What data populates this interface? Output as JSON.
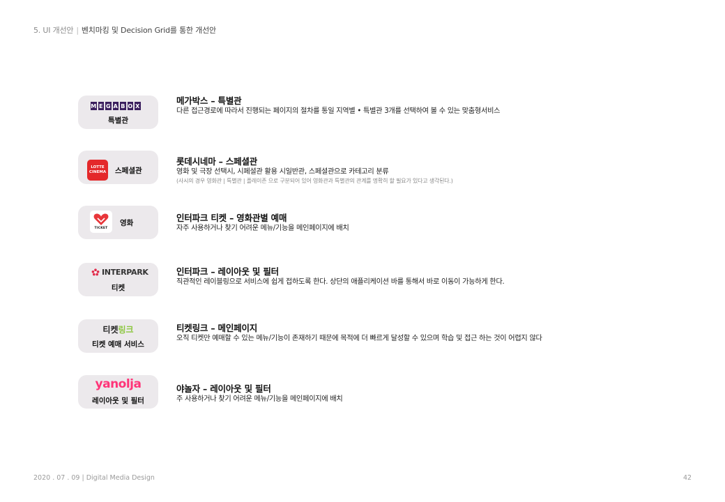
{
  "header": {
    "section": "5. UI 개선안",
    "separator": "|",
    "title": "벤치마킹 및 Decision Grid를 통한 개선안"
  },
  "rows": [
    {
      "badge": {
        "logo_letters": [
          "M",
          "E",
          "G",
          "A",
          "B",
          "O",
          "X"
        ],
        "label": "특별관"
      },
      "title": "메가박스 – 특별관",
      "desc": "다른 접근경로에 따라서 진행되는 페이지의 절차를 통일 지역별 • 특별관 3개를 선택하여 볼 수 있는 맞춤형서비스"
    },
    {
      "badge": {
        "logo_line1": "LOTTE",
        "logo_line2": "CINEMA",
        "label": "스페셜관"
      },
      "title": "롯데시네마 – 스페셜관",
      "desc": "영화 및 극장 선택시, 시페셜관 활용 시일반관, 스페셜관으로 카테고리 분류",
      "note": "(사시의 경우 영화관 | 특별관 | 플레이존 으로 구분되어 있어 영화관과 특별관의 관계를 명확히 할 필요가 있다고 생각된다.)"
    },
    {
      "badge": {
        "logo_text": "TICKET",
        "label": "영화"
      },
      "title": "인터파크 티켓 – 영화관별 예매",
      "desc": "자주 사용하거나 찾기 어려운 메뉴/기능을 메인페이지에 배치"
    },
    {
      "badge": {
        "logo_text": "INTERPARK",
        "label": "티켓"
      },
      "title": "인터파크  – 레이아웃 및 필터",
      "desc": "직관적인 레이블링으로 서비스에 쉽게 접하도록 한다. 상단의 애플리케이션 바를 통해서 바로 이동이 가능하게 한다."
    },
    {
      "badge": {
        "logo_a": "티켓",
        "logo_b": "링크",
        "label": "티켓 예매 서비스"
      },
      "title": "티켓링크 – 메인페이지",
      "desc": "오직 티켓만 예매할 수 있는 메뉴/기능이 존재하기 때문에 목적에 더 빠르게 달성할 수 있으며 학습 및 접근 하는 것이 어렵지 않다"
    },
    {
      "badge": {
        "logo_text": "yanolja",
        "label": "레이아웃 및 필터"
      },
      "title": "야놀자 – 레이아웃 및 필터",
      "desc": "주 사용하거나 찾기 어려운 메뉴/기능을 메인페이지에 배치"
    }
  ],
  "footer": {
    "left": "2020 . 07 . 09  |  Digital Media Design",
    "page": "42"
  },
  "colors": {
    "badge_bg": "#ece9ec",
    "megabox": "#3b1f5e",
    "lotte": "#e4282a",
    "ticket_heart": "#e8363a",
    "interpark_flower": "#e22b4a",
    "ticketlink_green": "#8cc63f",
    "yanolja": "#ff3478"
  }
}
